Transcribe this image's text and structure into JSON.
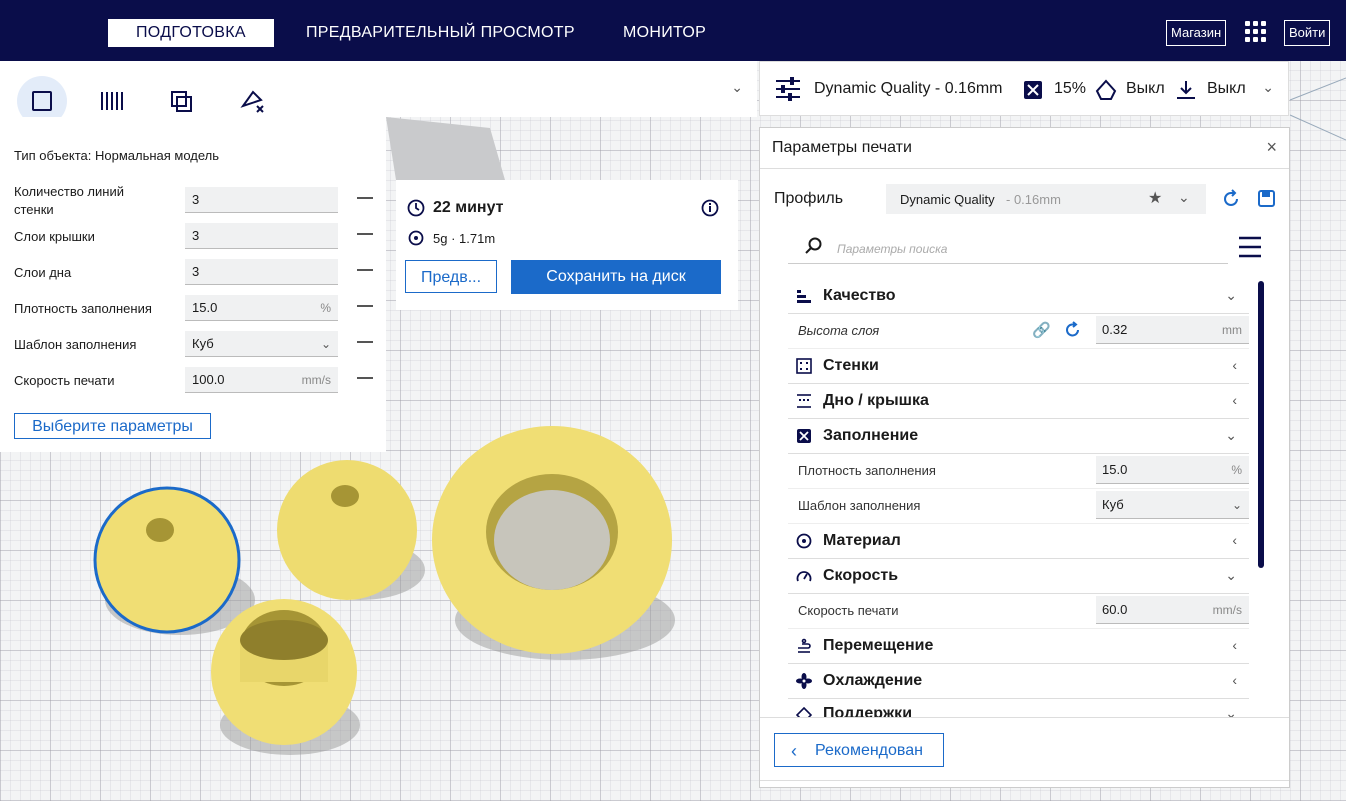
{
  "header": {
    "stages": [
      "ПОДГОТОВКА",
      "ПРЕДВАРИТЕЛЬНЫЙ ПРОСМОТР",
      "МОНИТОР"
    ],
    "active_stage": "ПОДГОТОВКА",
    "marketplace_label": "Магазин",
    "signin_label": "Войти"
  },
  "object_settings": {
    "object_type": "Тип объекта: Нормальная модель",
    "fields": [
      {
        "label": "Количество линий стенки",
        "value": "3",
        "unit": ""
      },
      {
        "label": "Слои крышки",
        "value": "3",
        "unit": ""
      },
      {
        "label": "Слои дна",
        "value": "3",
        "unit": ""
      },
      {
        "label": "Плотность заполнения",
        "value": "15.0",
        "unit": "%"
      },
      {
        "label": "Шаблон заполнения",
        "value": "Куб",
        "unit": ""
      },
      {
        "label": "Скорость печати",
        "value": "100.0",
        "unit": "mm/s"
      }
    ],
    "select_settings_label": "Выберите параметры"
  },
  "print_setup": {
    "profile": "Dynamic Quality - 0.16mm",
    "infill": "15%",
    "support": "Выкл",
    "adhesion": "Выкл"
  },
  "estimate": {
    "time": "22 минут",
    "material": "5g · 1.71m",
    "preview_label": "Предв...",
    "save_label": "Сохранить на диск"
  },
  "print_settings": {
    "title": "Параметры печати",
    "profile_label": "Профиль",
    "profile_name": "Dynamic Quality",
    "profile_layer": "- 0.16mm",
    "search_placeholder": "Параметры поиска",
    "categories": {
      "quality": "Качество",
      "layer_height": "Высота слоя",
      "layer_height_value": "0.32",
      "layer_height_unit": "mm",
      "walls": "Стенки",
      "topbottom": "Дно / крышка",
      "infill": "Заполнение",
      "infill_density": "Плотность заполнения",
      "infill_density_value": "15.0",
      "infill_density_unit": "%",
      "infill_pattern": "Шаблон заполнения",
      "infill_pattern_value": "Куб",
      "material": "Материал",
      "speed": "Скорость",
      "print_speed": "Скорость печати",
      "print_speed_value": "60.0",
      "print_speed_unit": "mm/s",
      "travel": "Перемещение",
      "cooling": "Охлаждение",
      "support": "Поддержки"
    },
    "recommended_label": "Рекомендован"
  },
  "colors": {
    "header_bg": "#0a0d4a",
    "accent": "#1b6ac9",
    "model": "#f0de74"
  }
}
